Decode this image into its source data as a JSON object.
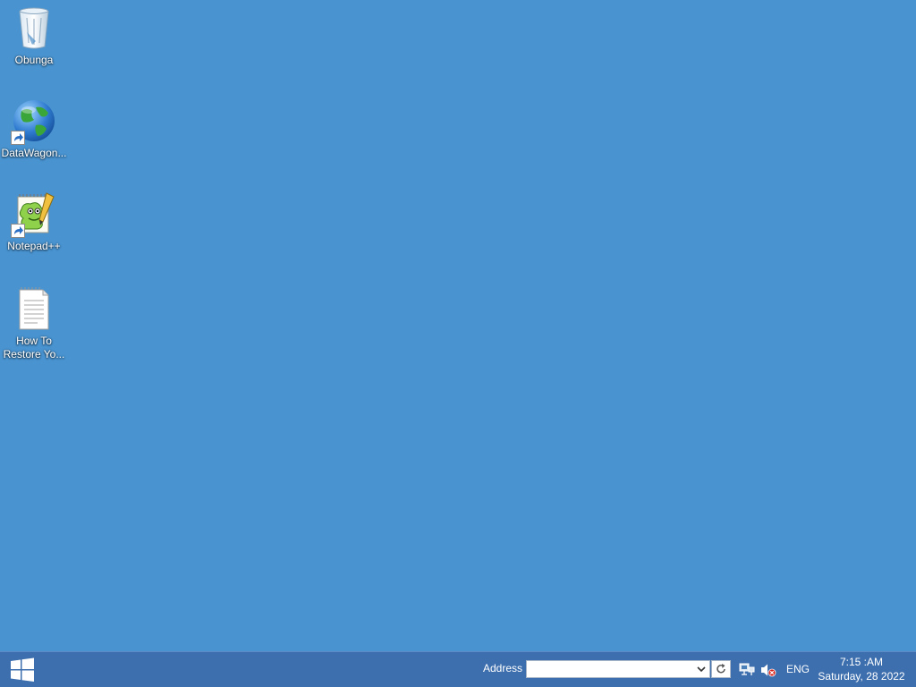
{
  "desktop": {
    "background_color": "#4893d0",
    "icons": [
      {
        "label": "Obunga",
        "icon": "recycle-bin-icon"
      },
      {
        "label": "DataWagon...",
        "icon": "globe-icon",
        "shortcut": true
      },
      {
        "label": "Notepad++",
        "icon": "notepad-plus-plus-icon",
        "shortcut": true
      },
      {
        "label": "How To Restore Yo...",
        "icon": "text-document-icon"
      }
    ]
  },
  "taskbar": {
    "start_icon": "windows-logo-icon",
    "address": {
      "label": "Address",
      "value": "",
      "placeholder": ""
    },
    "tray": {
      "network_icon": "network-icon",
      "volume_icon": "volume-muted-icon",
      "language": "ENG"
    },
    "clock": {
      "time": "7:15 :AM",
      "date": "Saturday, 28 2022"
    }
  }
}
